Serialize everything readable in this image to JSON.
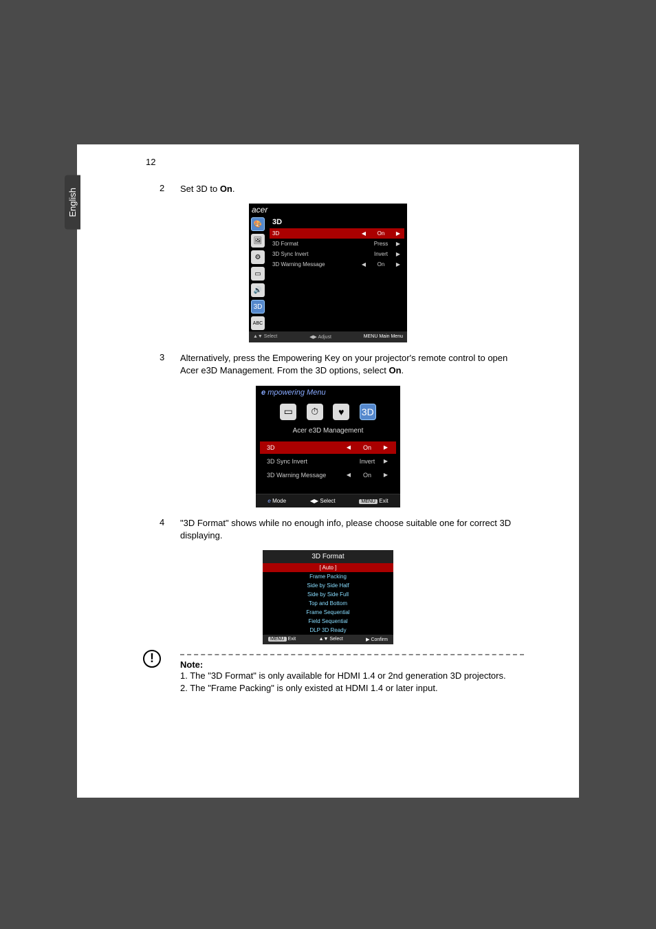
{
  "page_number": "12",
  "language_tab": "English",
  "step2": {
    "num": "2",
    "text_a": "Set 3D to ",
    "text_b": "On",
    "text_c": "."
  },
  "osd1": {
    "brand": "acer",
    "title": "3D",
    "rows": [
      {
        "label": "3D",
        "value": "On",
        "sel": true
      },
      {
        "label": "3D Format",
        "value": "Press",
        "sel": false
      },
      {
        "label": "3D Sync Invert",
        "value": "Invert",
        "sel": false
      },
      {
        "label": "3D Warning Message",
        "value": "On",
        "sel": false
      }
    ],
    "foot": {
      "select": "▲▼ Select",
      "adjust": "◀▶ Adjust",
      "main": "MENU Main Menu"
    }
  },
  "step3": {
    "num": "3",
    "text_a": "Alternatively, press the Empowering Key on your projector's remote control to open Acer e3D Management. From the 3D options, select ",
    "text_b": "On",
    "text_c": "."
  },
  "emp": {
    "title": "mpowering Menu",
    "subtitle": "Acer e3D Management",
    "rows": [
      {
        "label": "3D",
        "value": "On",
        "sel": true
      },
      {
        "label": "3D Sync Invert",
        "value": "Invert",
        "sel": false
      },
      {
        "label": "3D Warning Message",
        "value": "On",
        "sel": false
      }
    ],
    "foot": {
      "mode": "Mode",
      "select": "Select",
      "exit": "Exit",
      "menu": "MENU"
    }
  },
  "step4": {
    "num": "4",
    "text": "\"3D Format\" shows while no enough info, please choose suitable one for correct 3D displaying."
  },
  "fmt": {
    "title": "3D Format",
    "items": [
      "[ Auto ]",
      "Frame Packing",
      "Side by Side Half",
      "Side by Side Full",
      "Top and Bottom",
      "Frame Sequential",
      "Field Sequential",
      "DLP 3D Ready"
    ],
    "foot": {
      "exit": "Exit",
      "select": "▲▼ Select",
      "confirm": "▶ Confirm",
      "menu": "MENU"
    }
  },
  "note": {
    "title": "Note:",
    "line1": "1. The \"3D Format\" is only available for HDMI 1.4 or 2nd generation 3D projectors.",
    "line2": "2. The \"Frame Packing\" is only existed at HDMI 1.4 or later input."
  }
}
